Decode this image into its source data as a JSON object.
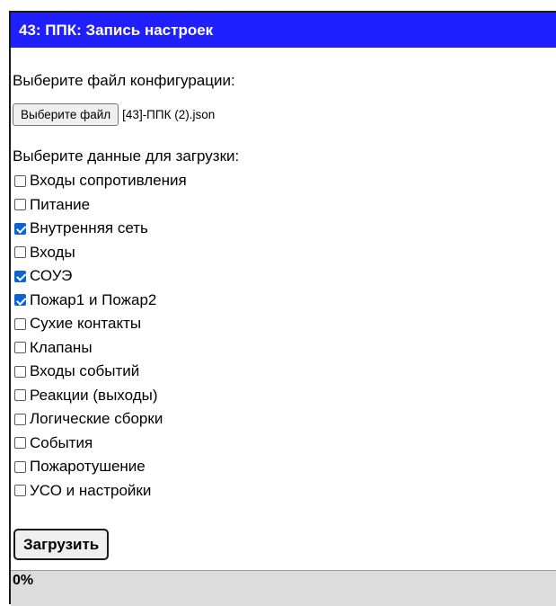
{
  "title": "43: ППК: Запись настроек",
  "file_section": {
    "label": "Выберите файл конфигурации:",
    "button_label": "Выберите файл",
    "file_name": "[43]-ППК (2).json"
  },
  "data_section": {
    "label": "Выберите данные для загрузки:",
    "items": [
      {
        "label": "Входы сопротивления",
        "checked": false
      },
      {
        "label": "Питание",
        "checked": false
      },
      {
        "label": "Внутренняя сеть",
        "checked": true
      },
      {
        "label": "Входы",
        "checked": false
      },
      {
        "label": "СОУЭ",
        "checked": true
      },
      {
        "label": "Пожар1 и Пожар2",
        "checked": true
      },
      {
        "label": "Сухие контакты",
        "checked": false
      },
      {
        "label": "Клапаны",
        "checked": false
      },
      {
        "label": "Входы событий",
        "checked": false
      },
      {
        "label": "Реакции (выходы)",
        "checked": false
      },
      {
        "label": "Логические сборки",
        "checked": false
      },
      {
        "label": "События",
        "checked": false
      },
      {
        "label": "Пожаротушение",
        "checked": false
      },
      {
        "label": "УСО и настройки",
        "checked": false
      }
    ]
  },
  "upload_button_label": "Загрузить",
  "progress": {
    "value": 0,
    "text": "0%"
  },
  "colors": {
    "title_bar": "#1f1fff",
    "checkbox_checked": "#0b63d6",
    "progress_track": "#dcdcdc"
  },
  "icons": {
    "checked": "checkbox-checked-icon",
    "unchecked": "checkbox-unchecked-icon"
  }
}
